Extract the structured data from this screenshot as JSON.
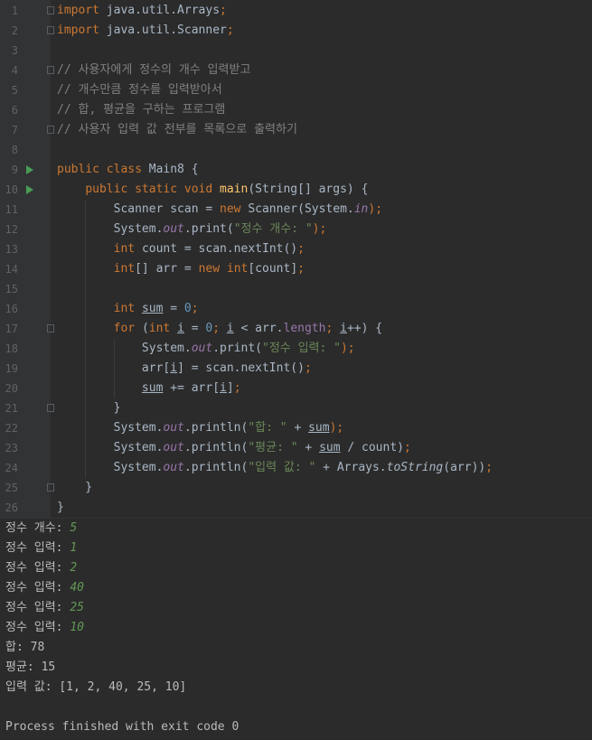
{
  "editor": {
    "line_numbers": [
      "1",
      "2",
      "3",
      "4",
      "5",
      "6",
      "7",
      "8",
      "9",
      "10",
      "11",
      "12",
      "13",
      "14",
      "15",
      "16",
      "17",
      "18",
      "19",
      "20",
      "21",
      "22",
      "23",
      "24",
      "25",
      "26"
    ],
    "lines": [
      [
        {
          "t": "import",
          "c": "kw"
        },
        {
          "t": " java.util.Arrays"
        },
        {
          "t": ";",
          "c": "kw"
        }
      ],
      [
        {
          "t": "import",
          "c": "kw"
        },
        {
          "t": " java.util.Scanner"
        },
        {
          "t": ";",
          "c": "kw"
        }
      ],
      [],
      [
        {
          "t": "// 사용자에게 정수의 개수 입력받고",
          "c": "cm"
        }
      ],
      [
        {
          "t": "// 개수만큼 정수를 입력받아서",
          "c": "cm"
        }
      ],
      [
        {
          "t": "// 합, 평균을 구하는 프로그램",
          "c": "cm"
        }
      ],
      [
        {
          "t": "// 사용자 입력 값 전부를 목록으로 출력하기",
          "c": "cm"
        }
      ],
      [],
      [
        {
          "t": "public class ",
          "c": "kw"
        },
        {
          "t": "Main8 {"
        }
      ],
      [
        {
          "t": "    "
        },
        {
          "t": "public static void ",
          "c": "kw"
        },
        {
          "t": "main",
          "c": "fn"
        },
        {
          "t": "(String[] args) {"
        }
      ],
      [
        {
          "t": "        Scanner scan = "
        },
        {
          "t": "new ",
          "c": "kw"
        },
        {
          "t": "Scanner(System."
        },
        {
          "t": "in",
          "c": "fld"
        },
        {
          "t": ");",
          "c": "kw"
        }
      ],
      [
        {
          "t": "        System."
        },
        {
          "t": "out",
          "c": "fld"
        },
        {
          "t": ".print("
        },
        {
          "t": "\"정수 개수: \"",
          "c": "str"
        },
        {
          "t": ");",
          "c": "kw"
        }
      ],
      [
        {
          "t": "        "
        },
        {
          "t": "int ",
          "c": "kw"
        },
        {
          "t": "count = scan.nextInt()"
        },
        {
          "t": ";",
          "c": "kw"
        }
      ],
      [
        {
          "t": "        "
        },
        {
          "t": "int",
          "c": "kw"
        },
        {
          "t": "[] arr = "
        },
        {
          "t": "new ",
          "c": "kw"
        },
        {
          "t": "int",
          "c": "kw"
        },
        {
          "t": "[count]"
        },
        {
          "t": ";",
          "c": "kw"
        }
      ],
      [],
      [
        {
          "t": "        "
        },
        {
          "t": "int ",
          "c": "kw"
        },
        {
          "t": "sum",
          "c": "ul"
        },
        {
          "t": " = "
        },
        {
          "t": "0",
          "c": "num"
        },
        {
          "t": ";",
          "c": "kw"
        }
      ],
      [
        {
          "t": "        "
        },
        {
          "t": "for ",
          "c": "kw"
        },
        {
          "t": "("
        },
        {
          "t": "int ",
          "c": "kw"
        },
        {
          "t": "i",
          "c": "ul"
        },
        {
          "t": " = "
        },
        {
          "t": "0",
          "c": "num"
        },
        {
          "t": "; ",
          "c": "kw"
        },
        {
          "t": "i",
          "c": "ul"
        },
        {
          "t": " < arr."
        },
        {
          "t": "length",
          "c": "prop"
        },
        {
          "t": "; ",
          "c": "kw"
        },
        {
          "t": "i",
          "c": "ul"
        },
        {
          "t": "++) {"
        }
      ],
      [
        {
          "t": "            System."
        },
        {
          "t": "out",
          "c": "fld"
        },
        {
          "t": ".print("
        },
        {
          "t": "\"정수 입력: \"",
          "c": "str"
        },
        {
          "t": ");",
          "c": "kw"
        }
      ],
      [
        {
          "t": "            arr["
        },
        {
          "t": "i",
          "c": "ul"
        },
        {
          "t": "] = scan.nextInt()"
        },
        {
          "t": ";",
          "c": "kw"
        }
      ],
      [
        {
          "t": "            "
        },
        {
          "t": "sum",
          "c": "ul"
        },
        {
          "t": " += arr["
        },
        {
          "t": "i",
          "c": "ul"
        },
        {
          "t": "]"
        },
        {
          "t": ";",
          "c": "kw"
        }
      ],
      [
        {
          "t": "        }"
        }
      ],
      [
        {
          "t": "        System."
        },
        {
          "t": "out",
          "c": "fld"
        },
        {
          "t": ".println("
        },
        {
          "t": "\"합: \"",
          "c": "str"
        },
        {
          "t": " + "
        },
        {
          "t": "sum",
          "c": "ul"
        },
        {
          "t": ");",
          "c": "kw"
        }
      ],
      [
        {
          "t": "        System."
        },
        {
          "t": "out",
          "c": "fld"
        },
        {
          "t": ".println("
        },
        {
          "t": "\"평균: \"",
          "c": "str"
        },
        {
          "t": " + "
        },
        {
          "t": "sum",
          "c": "ul"
        },
        {
          "t": " / count)"
        },
        {
          "t": ";",
          "c": "kw"
        }
      ],
      [
        {
          "t": "        System."
        },
        {
          "t": "out",
          "c": "fld"
        },
        {
          "t": ".println("
        },
        {
          "t": "\"입력 값: \"",
          "c": "str"
        },
        {
          "t": " + Arrays."
        },
        {
          "t": "toString",
          "c": "it"
        },
        {
          "t": "(arr))"
        },
        {
          "t": ";",
          "c": "kw"
        }
      ],
      [
        {
          "t": "    }"
        }
      ],
      [
        {
          "t": "}"
        }
      ]
    ],
    "run_markers": [
      9,
      10
    ],
    "fold_markers": [
      1,
      2,
      4,
      7,
      17,
      21,
      25
    ],
    "colors": {
      "keyword": "#cc7832",
      "string": "#6a8759",
      "number": "#6897bb",
      "comment": "#808080",
      "method": "#ffc66d",
      "field": "#9876aa",
      "run_icon": "#499c54",
      "console_input": "#629755"
    }
  },
  "console": {
    "lines": [
      {
        "label": "정수 개수: ",
        "input": "5"
      },
      {
        "label": "정수 입력: ",
        "input": "1"
      },
      {
        "label": "정수 입력: ",
        "input": "2"
      },
      {
        "label": "정수 입력: ",
        "input": "40"
      },
      {
        "label": "정수 입력: ",
        "input": "25"
      },
      {
        "label": "정수 입력: ",
        "input": "10"
      },
      {
        "label": "합: 78",
        "input": ""
      },
      {
        "label": "평균: 15",
        "input": ""
      },
      {
        "label": "입력 값: [1, 2, 40, 25, 10]",
        "input": ""
      },
      {
        "label": "",
        "input": ""
      },
      {
        "label": "Process finished with exit code 0",
        "input": ""
      }
    ]
  }
}
